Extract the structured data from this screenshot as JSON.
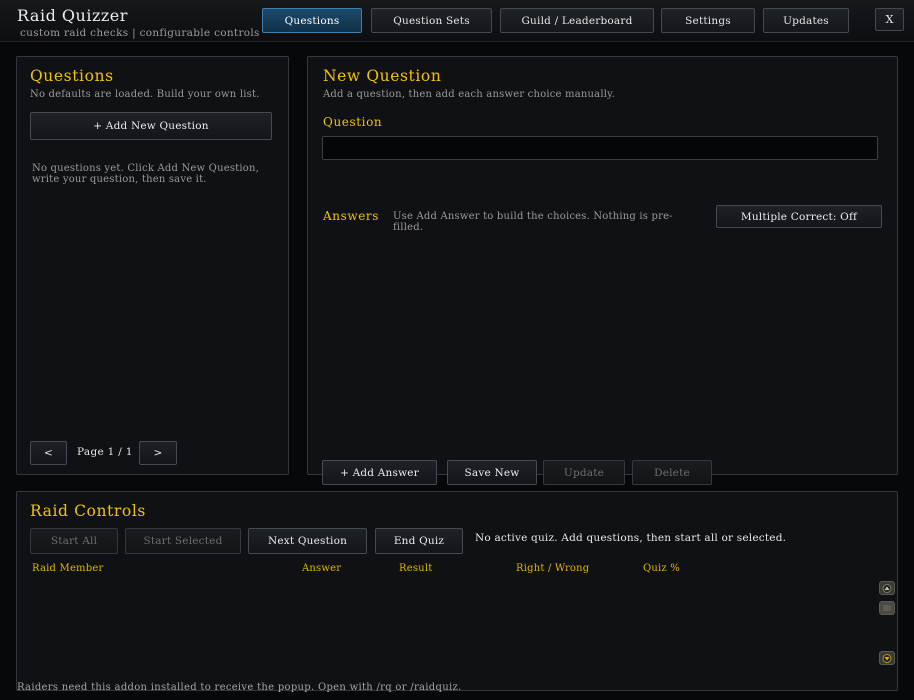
{
  "app": {
    "title": "Raid Quizzer",
    "subtitle": "custom raid checks | configurable controls"
  },
  "nav": {
    "tabs": [
      {
        "label": "Questions",
        "active": true
      },
      {
        "label": "Question Sets",
        "active": false
      },
      {
        "label": "Guild / Leaderboard",
        "active": false
      },
      {
        "label": "Settings",
        "active": false
      },
      {
        "label": "Updates",
        "active": false
      }
    ],
    "close_label": "X"
  },
  "questions_panel": {
    "title": "Questions",
    "subtitle": "No defaults are loaded. Build your own list.",
    "add_button": "+ Add New Question",
    "empty_line1": "No questions yet. Click Add New Question,",
    "empty_line2": "write your question, then save it.",
    "prev_button": "<",
    "page_label": "Page 1 / 1",
    "next_button": ">"
  },
  "editor_panel": {
    "title": "New Question",
    "subtitle": "Add a question, then add each answer choice manually.",
    "question_label": "Question",
    "question_value": "",
    "answers_label": "Answers",
    "answers_hint_line1": "Use Add Answer to build the choices. Nothing is pre-",
    "answers_hint_line2": "filled.",
    "multiple_correct_button": "Multiple Correct: Off",
    "add_answer_button": "+ Add Answer",
    "save_new_button": "Save New",
    "update_button": "Update",
    "delete_button": "Delete"
  },
  "raid_controls": {
    "title": "Raid Controls",
    "start_all_button": "Start All",
    "start_selected_button": "Start Selected",
    "next_question_button": "Next Question",
    "end_quiz_button": "End Quiz",
    "status_text": "No active quiz. Add questions, then start all or selected.",
    "columns": [
      "Raid Member",
      "Answer",
      "Result",
      "Right / Wrong",
      "Quiz %"
    ]
  },
  "footer": {
    "note": "Raiders need this addon installed to receive the popup. Open with /rq or /raidquiz."
  },
  "colors": {
    "accent_gold": "#f2c200",
    "active_tab": "#1c4a6b",
    "panel_bg": "#101114"
  },
  "icons": [
    "scroll-up-icon",
    "scroll-thumb-icon",
    "scroll-down-icon"
  ]
}
